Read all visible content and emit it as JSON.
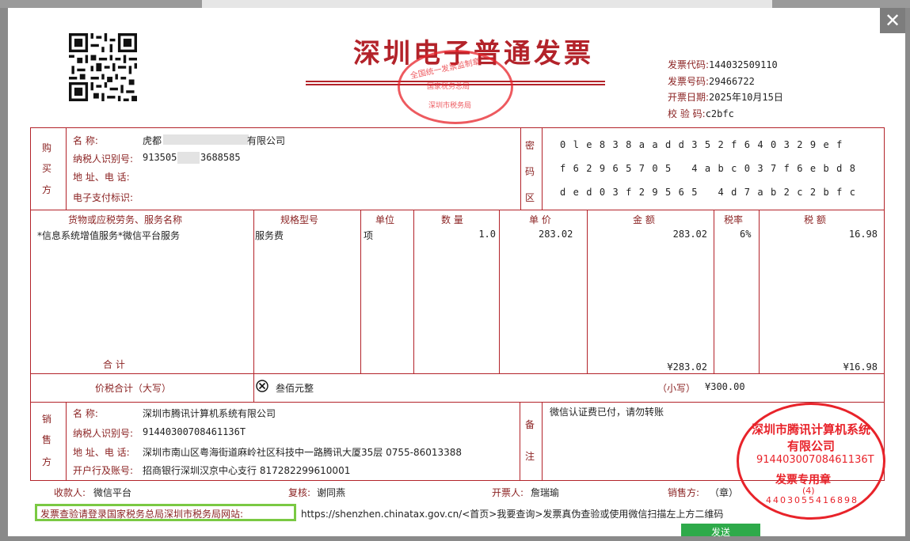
{
  "modal": {
    "close_label": "✕"
  },
  "invoice": {
    "title": "深圳电子普通发票",
    "meta": [
      {
        "label": "发票代码:",
        "value": "144032509110"
      },
      {
        "label": "发票号码:",
        "value": "29466722"
      },
      {
        "label": "开票日期:",
        "value": "2025年10月15日"
      },
      {
        "label": "校 验 码:",
        "value": "c2bfc"
      }
    ],
    "buyer": {
      "section_label": [
        "购",
        "买",
        "方"
      ],
      "name_label": "名        称:",
      "name": "虎都",
      "name_suffix": "有限公司",
      "tax_label": "纳税人识别号:",
      "tax_id_start": "913505",
      "tax_id_end": "3688585",
      "addr_label": "地 址、电 话:",
      "pay_label": "电子支付标识:"
    },
    "cipher": {
      "section_label": [
        "密",
        "码",
        "区"
      ],
      "rows": [
        "0le838aadd352f640329ef",
        "f62965705 4abc037f6ebd8",
        "ded03f29565 4d7ab2c2bfc"
      ]
    },
    "items_header": {
      "name": "货物或应税劳务、服务名称",
      "spec": "规格型号",
      "unit": "单位",
      "qty": "数 量",
      "price": "单 价",
      "amount": "金   额",
      "rate": "税率",
      "tax": "税   额"
    },
    "items": [
      {
        "name": "*信息系统增值服务*微信平台服务",
        "spec": "服务费",
        "unit": "项",
        "qty": "1.0",
        "price": "283.02",
        "amount": "283.02",
        "rate": "6%",
        "tax": "16.98"
      }
    ],
    "total": {
      "label": "合      计",
      "amount": "¥283.02",
      "tax": "¥16.98"
    },
    "grand_total": {
      "label": "价税合计（大写）",
      "words": "叁佰元整",
      "small_label": "（小写）",
      "small": "¥300.00"
    },
    "seller": {
      "section_label": [
        "销",
        "售",
        "方"
      ],
      "name_label": "名        称:",
      "name": "深圳市腾讯计算机系统有限公司",
      "tax_label": "纳税人识别号:",
      "tax_id": "91440300708461136T",
      "addr_label": "地 址、电 话:",
      "addr": "深圳市南山区粤海街道麻岭社区科技中一路腾讯大厦35层 0755-86013388",
      "bank_label": "开户行及账号:",
      "bank": "招商银行深圳汉京中心支行 817282299610001"
    },
    "remark": {
      "section_label": [
        "备",
        "注"
      ],
      "text": "微信认证费已付，请勿转账"
    },
    "footer": {
      "payee_label": "收款人:",
      "payee": "微信平台",
      "reviewer_label": "复核:",
      "reviewer": "谢同燕",
      "issuer_label": "开票人:",
      "issuer": "詹瑞瑜",
      "seller_label": "销售方:",
      "seller_seal": "（章）"
    },
    "verify": {
      "highlight": "发票查验请登录国家税务总局深圳市税务局网站:",
      "rest": "https://shenzhen.chinatax.gov.cn/<首页>我要查询>发票真伪查验或使用微信扫描左上方二维码"
    },
    "stamp_national": {
      "top": "全国统一发票监制章",
      "middle": "国家税务总局",
      "bottom": "深圳市税务局"
    },
    "stamp_seller": {
      "top": "深圳市腾讯计算机系统有限公司",
      "tax_id": "91440300708461136T",
      "label": "发票专用章",
      "count": "(4)",
      "bottom": "4403055416898"
    },
    "bottom_button": "发送"
  }
}
